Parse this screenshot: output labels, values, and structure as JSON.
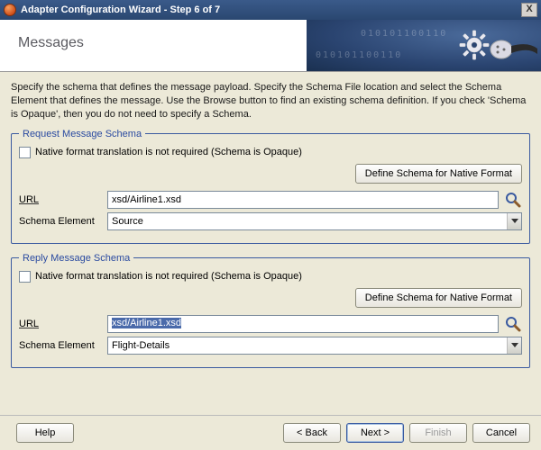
{
  "window": {
    "title": "Adapter Configuration Wizard - Step 6 of 7",
    "close_glyph": "X"
  },
  "banner": {
    "heading": "Messages",
    "binary_deco": "010101100110"
  },
  "intro": "Specify the schema that defines the message payload.  Specify the Schema File location and select the Schema Element that defines the message. Use the Browse button to find an existing schema definition. If you check 'Schema is Opaque', then you do not need to specify a Schema.",
  "request": {
    "legend": "Request Message Schema",
    "opaque_label": "Native format translation is not required (Schema is Opaque)",
    "define_btn": "Define Schema for Native Format",
    "url_label": "URL",
    "url_value": "xsd/Airline1.xsd",
    "element_label": "Schema Element",
    "element_value": "Source"
  },
  "reply": {
    "legend": "Reply Message Schema",
    "opaque_label": "Native format translation is not required (Schema is Opaque)",
    "define_btn": "Define Schema for Native Format",
    "url_label": "URL",
    "url_value": "xsd/Airline1.xsd",
    "element_label": "Schema Element",
    "element_value": "Flight-Details"
  },
  "footer": {
    "help": "Help",
    "back": "< Back",
    "next": "Next >",
    "finish": "Finish",
    "cancel": "Cancel"
  }
}
